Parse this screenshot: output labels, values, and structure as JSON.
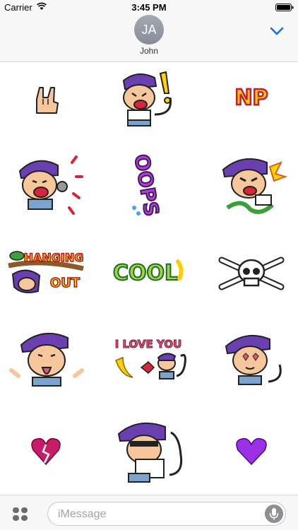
{
  "status_bar": {
    "carrier": "Carrier",
    "time": "3:45 PM",
    "wifi_icon": "wifi-icon",
    "battery_icon": "battery-icon"
  },
  "header": {
    "avatar_initials": "JA",
    "contact_name": "John",
    "collapse_icon": "chevron-down-icon",
    "accent_color": "#1a6fe0"
  },
  "stickers": {
    "rock_hand": "rock-hand-sticker",
    "monkey_shock": "monkey-shocked-sticker",
    "np_text": "NP",
    "monkey_sing": "monkey-singing-sticker",
    "oops_text": "OOPS",
    "monkey_angry": "monkey-angry-sticker",
    "hanging_text_1": "HANGING",
    "hanging_text_2": "OUT",
    "cool_text": "COOL",
    "skull": "skull-crossbones-sticker",
    "monkey_tongue": "monkey-tongue-sticker",
    "love_text": "I LOVE YOU",
    "monkey_heart_eyes": "monkey-heart-eyes-sticker",
    "broken_heart": "broken-heart-sticker",
    "monkey_sad": "monkey-sad-sticker",
    "purple_heart": "purple-heart-sticker"
  },
  "input_bar": {
    "apps_icon": "app-drawer-icon",
    "placeholder": "iMessage",
    "mic_icon": "microphone-icon"
  }
}
